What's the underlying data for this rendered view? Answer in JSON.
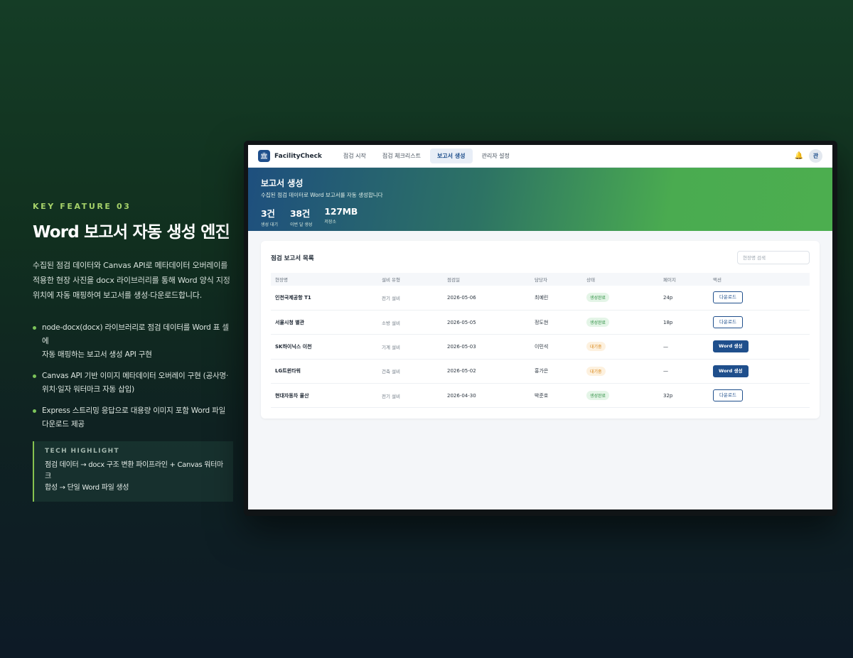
{
  "feature": {
    "kicker": "KEY FEATURE 03",
    "title": "Word 보고서 자동 생성 엔진",
    "description_lines": [
      "수집된 점검 데이터와 Canvas API로 메타데이터 오버레이를",
      "적용한 현장 사진을 docx 라이브러리를 통해 Word 양식 지정",
      "위치에 자동 매핑하여 보고서를 생성·다운로드합니다."
    ],
    "bullets": [
      [
        "node-docx(docx) 라이브러리로 점검 데이터를 Word 표 셀에",
        "자동 매핑하는 보고서 생성 API 구현"
      ],
      [
        "Canvas API 기반 이미지 메타데이터 오버레이 구현 (공사명·",
        "위치·일자 워터마크 자동 삽입)"
      ],
      [
        "Express 스트리밍 응답으로 대용량 이미지 포함 Word 파일",
        "다운로드 제공"
      ]
    ],
    "highlight": {
      "title": "TECH HIGHLIGHT",
      "lines": [
        "점검 데이터 → docx 구조 변환 파이프라인 + Canvas 워터마크",
        "합성 → 단일 Word 파일 생성"
      ]
    }
  },
  "app": {
    "brand": "FacilityCheck",
    "brand_icon": "🏛",
    "nav": [
      {
        "label": "점검 시작",
        "active": false
      },
      {
        "label": "점검 체크리스트",
        "active": false
      },
      {
        "label": "보고서 생성",
        "active": true
      },
      {
        "label": "관리자 설정",
        "active": false
      }
    ],
    "bell_icon": "🔔",
    "avatar": "관",
    "hero": {
      "title": "보고서 생성",
      "subtitle": "수집된 점검 데이터로 Word 보고서를 자동 생성합니다",
      "stats": [
        {
          "value": "3건",
          "label": "생성 대기"
        },
        {
          "value": "38건",
          "label": "이번 달 생성"
        },
        {
          "value": "127MB",
          "label": "저장소"
        }
      ]
    },
    "card": {
      "title": "점검 보고서 목록",
      "search_placeholder": "현장명 검색",
      "columns": [
        "현장명",
        "설비 유형",
        "점검일",
        "담당자",
        "상태",
        "페이지",
        "액션"
      ],
      "rows": [
        {
          "site": "인천국제공항 T1",
          "type": "전기 설비",
          "date": "2026-05-06",
          "owner": "최예린",
          "status": "생성완료",
          "status_kind": "done",
          "pages": "24p",
          "action": "다운로드",
          "action_kind": "outline"
        },
        {
          "site": "서울시청 별관",
          "type": "소방 설비",
          "date": "2026-05-05",
          "owner": "정도현",
          "status": "생성완료",
          "status_kind": "done",
          "pages": "18p",
          "action": "다운로드",
          "action_kind": "outline"
        },
        {
          "site": "SK하이닉스 이천",
          "type": "기계 설비",
          "date": "2026-05-03",
          "owner": "이민석",
          "status": "대기중",
          "status_kind": "wait",
          "pages": "—",
          "action": "Word 생성",
          "action_kind": "solid"
        },
        {
          "site": "LG트윈타워",
          "type": "건축 설비",
          "date": "2026-05-02",
          "owner": "홍가은",
          "status": "대기중",
          "status_kind": "wait",
          "pages": "—",
          "action": "Word 생성",
          "action_kind": "solid"
        },
        {
          "site": "현대자동차 울산",
          "type": "전기 설비",
          "date": "2026-04-30",
          "owner": "박준호",
          "status": "생성완료",
          "status_kind": "done",
          "pages": "32p",
          "action": "다운로드",
          "action_kind": "outline"
        }
      ]
    }
  },
  "colors": {
    "accent_green": "#a7d36a",
    "primary_blue": "#1f4f8c",
    "done_green": "#2f8f43",
    "wait_orange": "#d9891b"
  }
}
